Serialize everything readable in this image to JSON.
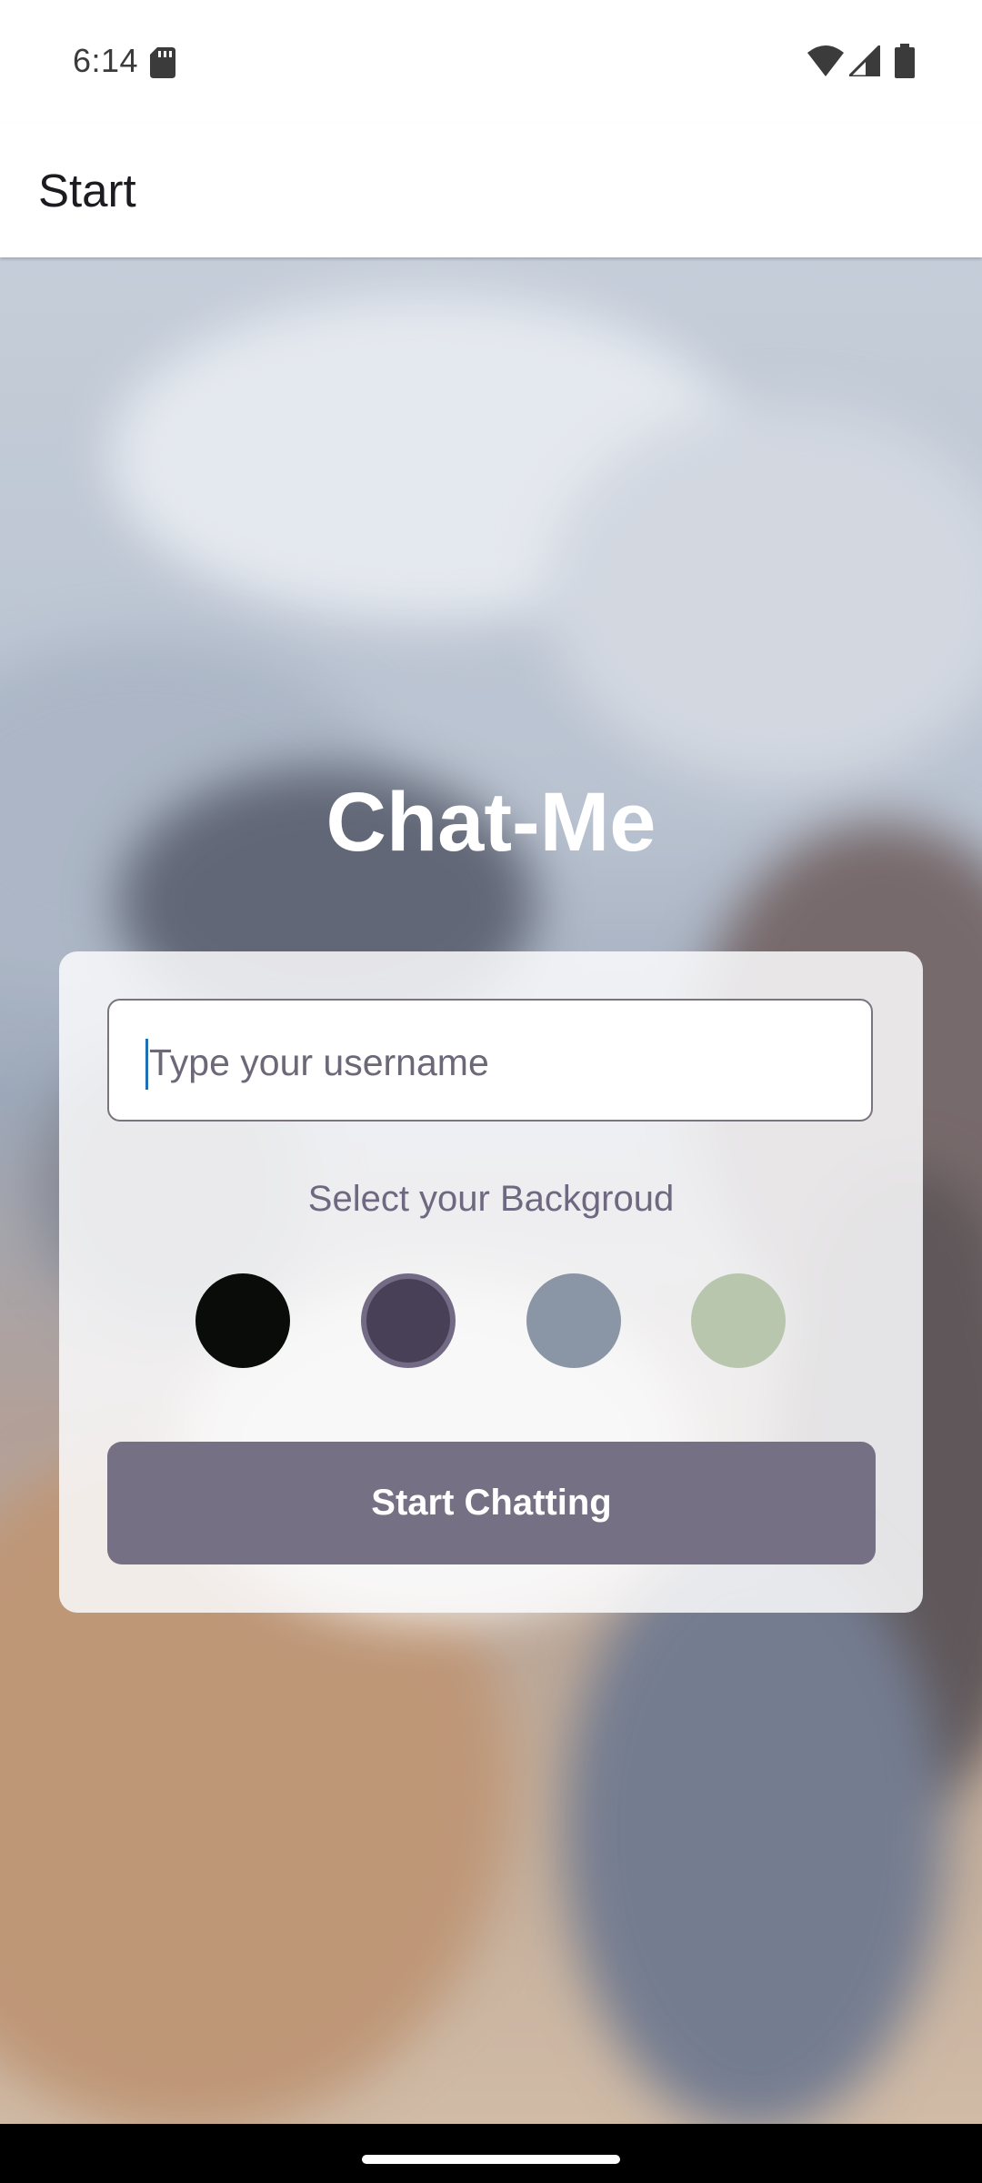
{
  "status_bar": {
    "time": "6:14",
    "icons": [
      "sd-card-icon",
      "wifi-icon",
      "signal-icon",
      "battery-icon"
    ]
  },
  "app_bar": {
    "title": "Start"
  },
  "main": {
    "app_title": "Chat-Me",
    "username": {
      "value": "",
      "placeholder": "Type your username"
    },
    "background_label": "Select your Backgroud",
    "background_colors": [
      "#090C08",
      "#474056",
      "#8A95A5",
      "#B9C6AE"
    ],
    "selected_color": "#474056",
    "start_button_label": "Start Chatting",
    "start_button_color": "#757083"
  }
}
